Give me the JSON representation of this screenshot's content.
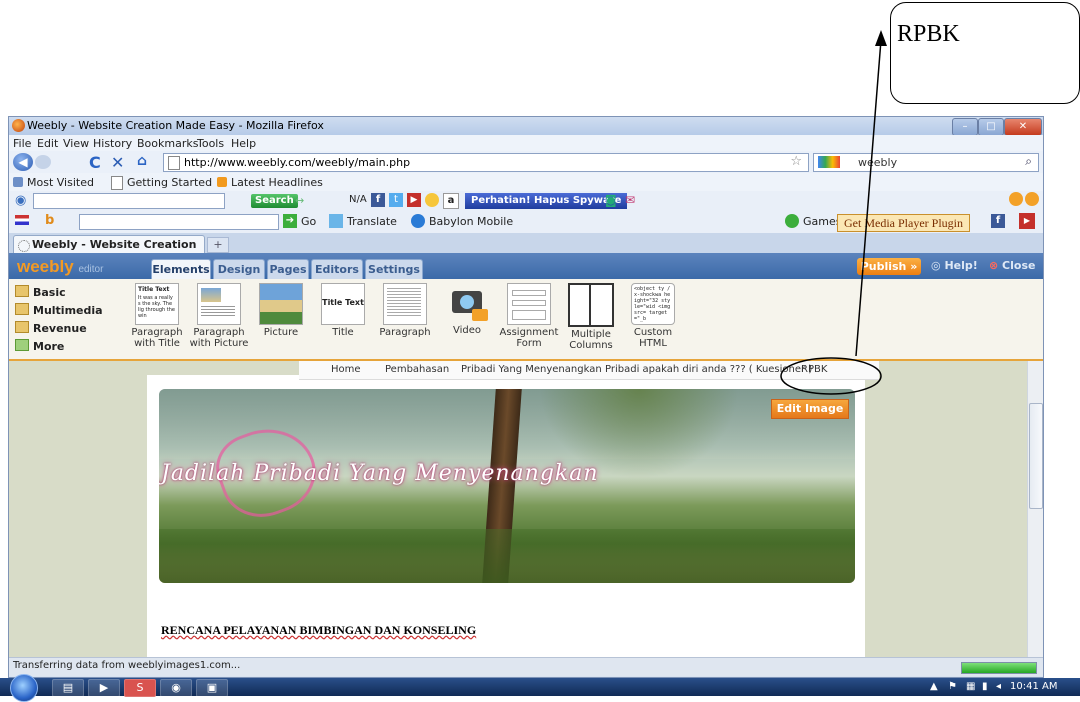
{
  "annotation": {
    "label": "RPBK"
  },
  "browser": {
    "window_title": "Weebly - Website Creation Made Easy - Mozilla Firefox",
    "menu": [
      "File",
      "Edit",
      "View",
      "History",
      "Bookmarks",
      "Tools",
      "Help"
    ],
    "url": "http://www.weebly.com/weebly/main.php",
    "search_value": "weebly",
    "bookmarks": [
      "Most Visited",
      "Getting Started",
      "Latest Headlines"
    ],
    "toolbar": {
      "search_label": "Search",
      "na_label": "N/A",
      "spyware_button": "Perhatian! Hapus Spyware",
      "go_label": "Go",
      "translate_label": "Translate",
      "babylon_label": "Babylon Mobile",
      "games_label": "Games",
      "media_player_button": "Get Media Player Plugin"
    },
    "tab_title": "Weebly - Website Creation Made Easy",
    "new_tab": "+",
    "status_text": "Transferring data from weeblyimages1.com...",
    "progress": 1.0
  },
  "weebly": {
    "logo": "weebly",
    "logo_suffix": "editor",
    "tabs": [
      "Elements",
      "Design",
      "Pages",
      "Editors",
      "Settings"
    ],
    "publish": "Publish »",
    "help": "Help!",
    "close": "Close",
    "categories": [
      "Basic",
      "Multimedia",
      "Revenue",
      "More"
    ],
    "elements": [
      {
        "label": "Paragraph with Title",
        "thumb_title": "Title Text",
        "thumb_body": "It was a really s the sky. The lig through the win"
      },
      {
        "label": "Paragraph with Picture"
      },
      {
        "label": "Picture"
      },
      {
        "label": "Title",
        "thumb_title": "Title Text"
      },
      {
        "label": "Paragraph"
      },
      {
        "label": "Video"
      },
      {
        "label": "Assignment Form"
      },
      {
        "label": "Multiple Columns"
      },
      {
        "label": "Custom HTML",
        "thumb_code": "<object ty /x-shockwa height=\"32 style=\"wid <img src= target=\"_b"
      }
    ]
  },
  "site": {
    "nav": [
      "Home",
      "Pembahasan",
      "Pribadi Yang Menyenangkan",
      "Pribadi apakah diri anda ??? ( Kuesioner )",
      "RPBK"
    ],
    "edit_image": "Edit Image",
    "banner_title": "Jadilah Pribadi Yang Menyenangkan",
    "heading": "RENCANA PELAYANAN BIMBINGAN DAN KONSELING"
  },
  "taskbar": {
    "clock": "10:41 AM"
  },
  "colors": {
    "weebly_orange": "#f39a24",
    "publish_orange": "#ed7f12",
    "editor_blue": "#3b6aa8"
  }
}
